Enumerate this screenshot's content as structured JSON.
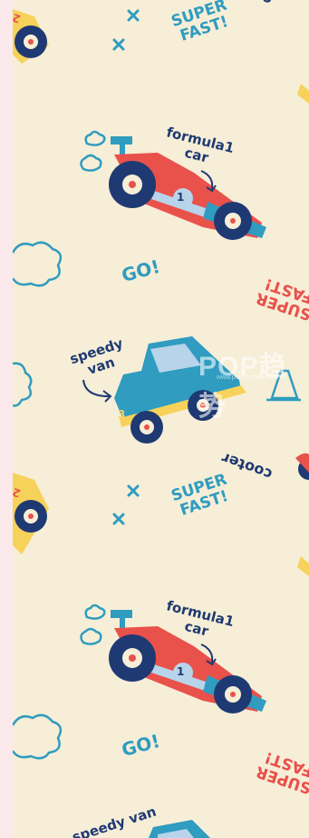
{
  "pattern": {
    "background_color": "#f7eed7",
    "border_color": "#fbe9ec",
    "colors": {
      "teal": "#2f9cc0",
      "navy": "#1f3a73",
      "red": "#e9514b",
      "yellow": "#f7d25b",
      "light_blue": "#b8d4ea"
    },
    "labels": {
      "super_fast": "SUPER FAST!",
      "formula1_car": "formula1 car",
      "go": "GO!",
      "speedy_van": "speedy van",
      "scooter_fragment": "cooter",
      "van_number": "3",
      "car_number": "1",
      "small_number": "2"
    },
    "watermark": {
      "main": "POP趋势",
      "sub": "www.pop-fashion.com"
    }
  }
}
